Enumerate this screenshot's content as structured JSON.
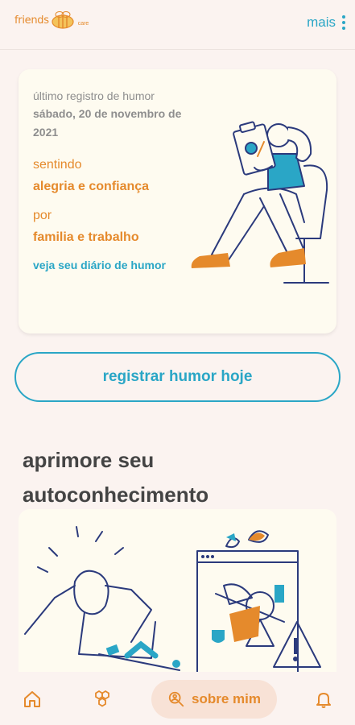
{
  "header": {
    "logo_text": "friends",
    "logo_sub": "care",
    "menu_label": "mais"
  },
  "mood_card": {
    "last_record_label": "último registro de humor",
    "date": "sábado, 20 de novembro de 2021",
    "feeling_label": "sentindo",
    "feeling_value": "alegria e confiança",
    "reason_label": "por",
    "reason_value": "familia e trabalho",
    "diary_link": "veja seu diário de humor"
  },
  "register_button": "registrar humor hoje",
  "section": {
    "title": "aprimore seu autoconhecimento"
  },
  "bottom_nav": {
    "items": [
      {
        "icon": "home-icon"
      },
      {
        "icon": "hexagons-icon"
      },
      {
        "icon": "search-person-icon",
        "label": "sobre mim",
        "active": true
      },
      {
        "icon": "bell-icon"
      }
    ]
  },
  "colors": {
    "background": "#fbf3f0",
    "card": "#fefbf0",
    "accent_orange": "#e58a2c",
    "accent_blue": "#2aa6c6",
    "illustration_navy": "#2b3a7c"
  }
}
